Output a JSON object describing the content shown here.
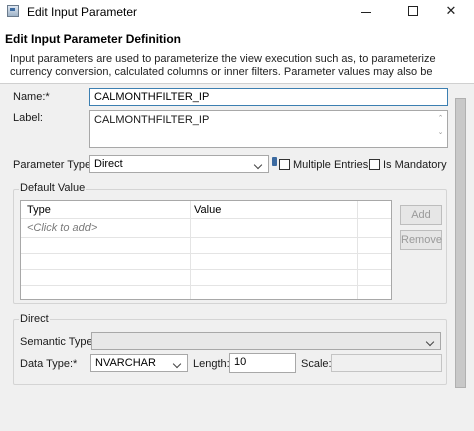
{
  "window": {
    "title": "Edit Input Parameter",
    "minimize_icon": "minimize-icon",
    "maximize_icon": "maximize-icon",
    "close_icon": "close-icon",
    "close_glyph": "✕"
  },
  "header": {
    "title": "Edit Input Parameter Definition",
    "description_line1": "Input parameters are used to parameterize the view execution such as, to parameterize",
    "description_line2": "currency conversion, calculated columns or inner filters. Parameter values may also be"
  },
  "form": {
    "name_label": "Name:*",
    "name_value": "CALMONTHFILTER_IP",
    "label_label": "Label:",
    "label_value": "CALMONTHFILTER_IP",
    "parameter_type_label": "Parameter Type:",
    "parameter_type_value": "Direct",
    "multiple_entries_label": "Multiple Entries",
    "is_mandatory_label": "Is Mandatory"
  },
  "default_value": {
    "group_label": "Default Value",
    "columns": [
      "Type",
      "Value"
    ],
    "placeholder_row": "<Click to add>",
    "add_button": "Add",
    "remove_button": "Remove"
  },
  "direct": {
    "group_label": "Direct",
    "semantic_type_label": "Semantic Type:",
    "semantic_type_value": "",
    "data_type_label": "Data Type:*",
    "data_type_value": "NVARCHAR",
    "length_label": "Length:",
    "length_value": "10",
    "scale_label": "Scale:",
    "scale_value": ""
  },
  "colors": {
    "focus_border": "#3c7fb1",
    "content_bg": "#f0f0f0"
  }
}
